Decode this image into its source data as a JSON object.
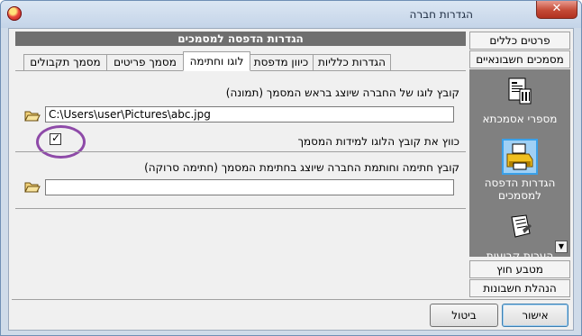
{
  "window": {
    "title": "הגדרות חברה",
    "close_glyph": "✕"
  },
  "nav": {
    "top_items": [
      {
        "label": "פרטים כללים"
      },
      {
        "label": "מסמכים חשבונאיים"
      }
    ],
    "panel_items": [
      {
        "label": "מספרי אסמכתא",
        "icon": "document-numbering-icon"
      },
      {
        "label_line1": "הגדרות הדפסה",
        "label_line2": "למסמכים",
        "icon": "printer-icon"
      },
      {
        "label": "הערות קבועות",
        "icon": "notes-icon"
      }
    ],
    "bottom_items": [
      {
        "label": "מטבע חוץ"
      },
      {
        "label": "הנהלת חשבונות"
      }
    ]
  },
  "main": {
    "section_title": "הגדרות הדפסה למסמכים",
    "tabs": [
      {
        "label": "הגדרות כלליות"
      },
      {
        "label": "כיוון מדפסת"
      },
      {
        "label": "לוגו וחתימה",
        "active": true
      },
      {
        "label": "מסמך פריטים"
      },
      {
        "label": "מסמך תקבולים"
      }
    ],
    "logo": {
      "label": "קובץ לוגו של החברה שיוצג בראש המסמך (תמונה)",
      "path": "C:\\Users\\user\\Pictures\\abc.jpg",
      "fit_label": "כווץ את קובץ הלוגו למידות המסמך",
      "fit_checked": true,
      "check_glyph": "✓"
    },
    "signature": {
      "label": "קובץ חתימה וחותמת החברה שיוצג בחתימת המסמך (חתימה סרוקה)",
      "path": ""
    }
  },
  "buttons": {
    "ok": "אישור",
    "cancel": "ביטול"
  },
  "colors": {
    "highlight_ring": "#8e4aa8",
    "nav_panel": "#808080",
    "section_header": "#6f6f6f"
  }
}
